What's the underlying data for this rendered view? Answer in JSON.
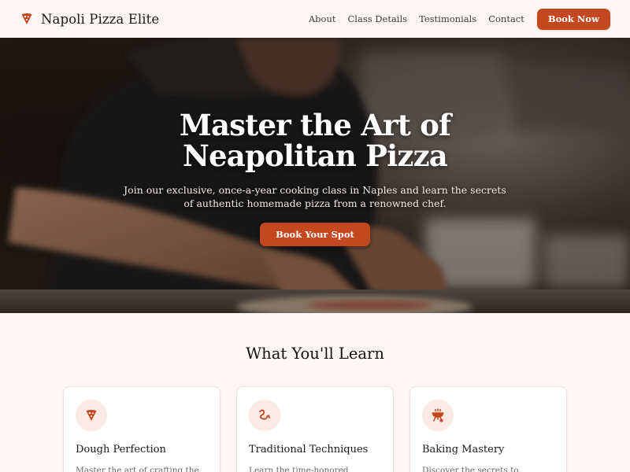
{
  "brand": {
    "name": "Napoli Pizza Elite",
    "icon": "pizza-slice-icon",
    "accent_color": "#c4481f"
  },
  "nav": {
    "links": [
      {
        "label": "About"
      },
      {
        "label": "Class Details"
      },
      {
        "label": "Testimonials"
      },
      {
        "label": "Contact"
      }
    ],
    "cta_label": "Book Now"
  },
  "hero": {
    "title": "Master the Art of Neapolitan Pizza",
    "subtitle": "Join our exclusive, once-a-year cooking class in Naples and learn the secrets of authentic homemade pizza from a renowned chef.",
    "cta_label": "Book Your Spot"
  },
  "learn": {
    "title": "What You'll Learn",
    "cards": [
      {
        "icon": "pizza-slice-icon",
        "title": "Dough Perfection",
        "desc": "Master the art of crafting the"
      },
      {
        "icon": "wavy-line-icon",
        "title": "Traditional Techniques",
        "desc": "Learn the time-honored"
      },
      {
        "icon": "grill-icon",
        "title": "Baking Mastery",
        "desc": "Discover the secrets to achieving a"
      }
    ]
  }
}
